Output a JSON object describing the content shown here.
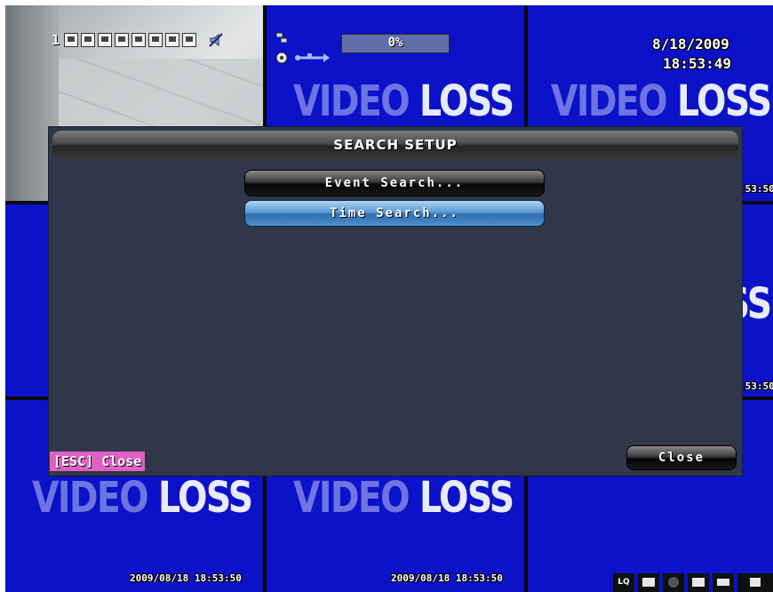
{
  "dvr": {
    "channel_number": "1",
    "progress_percent": "0%",
    "progress_value": 0,
    "date": "8/18/2009",
    "time": "18:53:49",
    "video_loss_word1": "VIDEO",
    "video_loss_word2": "LOSS",
    "timestamp": "2009/08/18 18:53:50",
    "timestamp_partial": ":53:50",
    "lq_label": "LQ"
  },
  "dialog": {
    "title": "SEARCH SETUP",
    "buttons": [
      "Event Search...",
      "Time Search..."
    ],
    "selected_index": 1,
    "close_label": "Close"
  },
  "hint": {
    "esc_text": "[ESC] Close"
  },
  "colors": {
    "tile_blue": "#0b12c8",
    "dialog_bg": "#303749",
    "highlight": "#4f8fcf",
    "esc_badge": "#e060c8"
  }
}
